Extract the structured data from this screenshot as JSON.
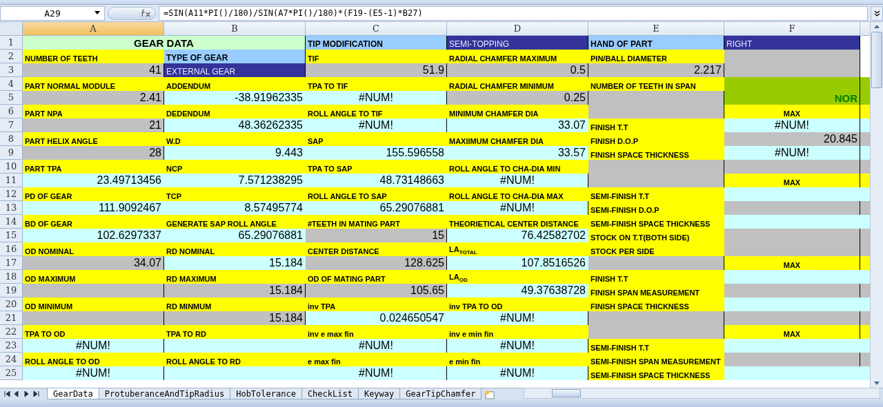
{
  "formula_bar": {
    "name_box": "A29",
    "formula": "=SIN(A11*PI()/180)/SIN(A7*PI()/180)*(F19-(E5-1)*B27)"
  },
  "columns": [
    {
      "label": "A",
      "selected": true
    },
    {
      "label": "B",
      "selected": false
    },
    {
      "label": "C",
      "selected": false
    },
    {
      "label": "D",
      "selected": false
    },
    {
      "label": "E",
      "selected": false
    },
    {
      "label": "F",
      "selected": false
    }
  ],
  "rows": [
    {
      "number": "1",
      "cells": [
        {
          "kind": "title",
          "text": "GEAR DATA"
        },
        {
          "kind": "heading",
          "text": "TIP MODIFICATION"
        },
        {
          "kind": "dark",
          "text": "SEMI-TOPPING"
        },
        {
          "kind": "heading",
          "text": "HAND OF PART"
        },
        {
          "kind": "dark",
          "text": "RIGHT"
        }
      ]
    },
    {
      "number": "2",
      "cells": [
        {
          "kind": "label",
          "text": "NUMBER OF TEETH"
        },
        {
          "kind": "heading",
          "text": "TYPE OF GEAR"
        },
        {
          "kind": "label",
          "text": "TIF"
        },
        {
          "kind": "label",
          "text": "RADIAL CHAMFER MAXIMUM"
        },
        {
          "kind": "label",
          "text": "PIN/BALL DIAMETER"
        },
        {
          "kind": "empty"
        }
      ]
    },
    {
      "number": "3",
      "cells": [
        {
          "kind": "input",
          "text": "41"
        },
        {
          "kind": "dark",
          "text": "EXTERNAL GEAR"
        },
        {
          "kind": "input",
          "text": "51.9"
        },
        {
          "kind": "input",
          "text": "0.5"
        },
        {
          "kind": "input",
          "text": "2.217"
        },
        {
          "kind": "empty"
        }
      ]
    },
    {
      "number": "4",
      "cells": [
        {
          "kind": "label",
          "text": "PART NORMAL MODULE"
        },
        {
          "kind": "label",
          "text": "ADDENDUM"
        },
        {
          "kind": "label",
          "text": "TPA TO TIF"
        },
        {
          "kind": "label",
          "text": "RADIAL CHAMFER MINIMUM"
        },
        {
          "kind": "label",
          "text": "NUMBER OF TEETH IN SPAN"
        },
        {
          "kind": "banner"
        }
      ]
    },
    {
      "number": "5",
      "cells": [
        {
          "kind": "input",
          "text": "2.41"
        },
        {
          "kind": "output",
          "text": "-38.91962335"
        },
        {
          "kind": "error",
          "text": "#NUM!"
        },
        {
          "kind": "input",
          "text": "0.25"
        },
        {
          "kind": "empty"
        },
        {
          "kind": "banner",
          "text": "NOR"
        }
      ]
    },
    {
      "number": "6",
      "cells": [
        {
          "kind": "label",
          "text": "PART NPA"
        },
        {
          "kind": "label",
          "text": "DEDENDUM"
        },
        {
          "kind": "label",
          "text": "ROLL ANGLE TO TIF"
        },
        {
          "kind": "label",
          "text": "MINIMUM CHAMFER DIA"
        },
        {
          "kind": "empty"
        },
        {
          "kind": "max",
          "text": "MAX"
        }
      ]
    },
    {
      "number": "7",
      "cells": [
        {
          "kind": "input",
          "text": "21"
        },
        {
          "kind": "output",
          "text": "48.36262335"
        },
        {
          "kind": "error",
          "text": "#NUM!"
        },
        {
          "kind": "output",
          "text": "33.07"
        },
        {
          "kind": "label",
          "text": "FINISH T.T"
        },
        {
          "kind": "error",
          "text": "#NUM!"
        }
      ]
    },
    {
      "number": "8",
      "cells": [
        {
          "kind": "label",
          "text": "PART HELIX ANGLE"
        },
        {
          "kind": "label",
          "text": "W.D"
        },
        {
          "kind": "label",
          "text": "SAP"
        },
        {
          "kind": "label",
          "text": "MAXIIMUM CHAMFER DIA"
        },
        {
          "kind": "label",
          "text": "FINISH D.O.P"
        },
        {
          "kind": "input",
          "text": "20.845"
        }
      ]
    },
    {
      "number": "9",
      "cells": [
        {
          "kind": "input",
          "text": "28"
        },
        {
          "kind": "output",
          "text": "9.443"
        },
        {
          "kind": "output",
          "text": "155.596558"
        },
        {
          "kind": "output",
          "text": "33.57"
        },
        {
          "kind": "label",
          "text": "FINISH SPACE THICKNESS"
        },
        {
          "kind": "error",
          "text": "#NUM!"
        }
      ]
    },
    {
      "number": "10",
      "cells": [
        {
          "kind": "label",
          "text": "PART TPA"
        },
        {
          "kind": "label",
          "text": "NCP"
        },
        {
          "kind": "label",
          "text": "TPA TO SAP"
        },
        {
          "kind": "label",
          "text": "ROLL ANGLE TO CHA-DIA MIN"
        },
        {
          "kind": "empty"
        },
        {
          "kind": "empty"
        }
      ]
    },
    {
      "number": "11",
      "cells": [
        {
          "kind": "output",
          "text": "23.49713456"
        },
        {
          "kind": "output",
          "text": "7.571238295"
        },
        {
          "kind": "output",
          "text": "48.73148663"
        },
        {
          "kind": "error",
          "text": "#NUM!"
        },
        {
          "kind": "empty"
        },
        {
          "kind": "max",
          "text": "MAX"
        }
      ]
    },
    {
      "number": "12",
      "cells": [
        {
          "kind": "label",
          "text": "PD OF GEAR"
        },
        {
          "kind": "label",
          "text": "TCP"
        },
        {
          "kind": "label",
          "text": "ROLL ANGLE TO SAP"
        },
        {
          "kind": "label",
          "text": "ROLL ANGLE TO CHA-DIA MAX"
        },
        {
          "kind": "label",
          "text": "SEMI-FINISH T.T"
        },
        {
          "kind": "output"
        }
      ]
    },
    {
      "number": "13",
      "cells": [
        {
          "kind": "output",
          "text": "111.9092467"
        },
        {
          "kind": "output",
          "text": "8.57495774"
        },
        {
          "kind": "output",
          "text": "65.29076881"
        },
        {
          "kind": "error",
          "text": "#NUM!"
        },
        {
          "kind": "label",
          "text": "SEMI-FINISH D.O.P"
        },
        {
          "kind": "empty"
        }
      ]
    },
    {
      "number": "14",
      "cells": [
        {
          "kind": "label",
          "text": "BD OF GEAR"
        },
        {
          "kind": "label",
          "text": "GENERATE SAP ROLL ANGLE"
        },
        {
          "kind": "label",
          "text": "#TEETH IN MATING PART"
        },
        {
          "kind": "label",
          "text": "THEORIETICAL CENTER DISTANCE"
        },
        {
          "kind": "label",
          "text": "SEMI-FINISH SPACE THICKNESS"
        },
        {
          "kind": "output"
        }
      ]
    },
    {
      "number": "15",
      "cells": [
        {
          "kind": "output",
          "text": "102.6297337"
        },
        {
          "kind": "output",
          "text": "65.29076881"
        },
        {
          "kind": "input",
          "text": "15"
        },
        {
          "kind": "output",
          "text": "76.42582702"
        },
        {
          "kind": "label",
          "text": "STOCK ON T.T(BOTH SIDE)"
        },
        {
          "kind": "empty"
        }
      ]
    },
    {
      "number": "16",
      "cells": [
        {
          "kind": "label",
          "text": "OD NOMINAL"
        },
        {
          "kind": "label",
          "text": "RD NOMINAL"
        },
        {
          "kind": "label",
          "text": "CENTER DISTANCE"
        },
        {
          "kind": "label",
          "text": "LA$_{TOTAL}$"
        },
        {
          "kind": "label",
          "text": "STOCK PER SIDE"
        },
        {
          "kind": "empty"
        }
      ]
    },
    {
      "number": "17",
      "cells": [
        {
          "kind": "input",
          "text": "34.07"
        },
        {
          "kind": "output",
          "text": "15.184"
        },
        {
          "kind": "input",
          "text": "128.625"
        },
        {
          "kind": "output",
          "text": "107.8516526"
        },
        {
          "kind": "empty"
        },
        {
          "kind": "max",
          "text": "MAX"
        }
      ]
    },
    {
      "number": "18",
      "cells": [
        {
          "kind": "label",
          "text": "OD MAXIMUM"
        },
        {
          "kind": "label",
          "text": "RD MAXIMUM"
        },
        {
          "kind": "label",
          "text": "OD OF MATING PART"
        },
        {
          "kind": "label",
          "text": "LA$_{OD}$"
        },
        {
          "kind": "label",
          "text": "FINISH T.T"
        },
        {
          "kind": "output"
        }
      ]
    },
    {
      "number": "19",
      "cells": [
        {
          "kind": "empty"
        },
        {
          "kind": "input",
          "text": "15.184"
        },
        {
          "kind": "input",
          "text": "105.65"
        },
        {
          "kind": "output",
          "text": "49.37638728"
        },
        {
          "kind": "label",
          "text": "FINISH SPAN MEASUREMENT"
        },
        {
          "kind": "empty"
        }
      ]
    },
    {
      "number": "20",
      "cells": [
        {
          "kind": "label",
          "text": "OD MINIMUM"
        },
        {
          "kind": "label",
          "text": "RD MINMUM"
        },
        {
          "kind": "label",
          "text": "inv TPA"
        },
        {
          "kind": "label",
          "text": "inv TPA TO OD"
        },
        {
          "kind": "label",
          "text": "FINISH SPACE THICKNESS"
        },
        {
          "kind": "output"
        }
      ]
    },
    {
      "number": "21",
      "cells": [
        {
          "kind": "empty"
        },
        {
          "kind": "input",
          "text": "15.184"
        },
        {
          "kind": "output",
          "text": "0.024650547"
        },
        {
          "kind": "error",
          "text": "#NUM!"
        },
        {
          "kind": "empty"
        },
        {
          "kind": "empty"
        }
      ]
    },
    {
      "number": "22",
      "cells": [
        {
          "kind": "label",
          "text": "TPA TO OD"
        },
        {
          "kind": "label",
          "text": "TPA TO RD"
        },
        {
          "kind": "label",
          "text": "inv e max fin"
        },
        {
          "kind": "label",
          "text": "inv e min fin"
        },
        {
          "kind": "empty"
        },
        {
          "kind": "max",
          "text": "MAX"
        }
      ]
    },
    {
      "number": "23",
      "cells": [
        {
          "kind": "error",
          "text": "#NUM!"
        },
        {
          "kind": "output"
        },
        {
          "kind": "error",
          "text": "#NUM!"
        },
        {
          "kind": "error",
          "text": "#NUM!"
        },
        {
          "kind": "label",
          "text": "SEMI-FINISH T.T"
        },
        {
          "kind": "output"
        }
      ]
    },
    {
      "number": "24",
      "cells": [
        {
          "kind": "label",
          "text": "ROLL ANGLE TO OD"
        },
        {
          "kind": "label",
          "text": "ROLL ANGLE TO RD"
        },
        {
          "kind": "label",
          "text": "e max fin"
        },
        {
          "kind": "label",
          "text": "e min fin"
        },
        {
          "kind": "label",
          "text": "SEMI-FINISH SPAN MEASUREMENT"
        },
        {
          "kind": "empty"
        }
      ]
    },
    {
      "number": "25",
      "cells": [
        {
          "kind": "error",
          "text": "#NUM!"
        },
        {
          "kind": "output"
        },
        {
          "kind": "error",
          "text": "#NUM!"
        },
        {
          "kind": "error",
          "text": "#NUM!"
        },
        {
          "kind": "label",
          "text": "SEMI-FINISH SPACE THICKNESS"
        },
        {
          "kind": "output"
        }
      ]
    }
  ],
  "sheet_tabs": [
    {
      "label": "GearData",
      "selected": true
    },
    {
      "label": "ProtuberanceAndTipRadius",
      "selected": false
    },
    {
      "label": "HobTolerance",
      "selected": false
    },
    {
      "label": "CheckList",
      "selected": false
    },
    {
      "label": "Keyway",
      "selected": false
    },
    {
      "label": "GearTipChamfer",
      "selected": false
    }
  ]
}
